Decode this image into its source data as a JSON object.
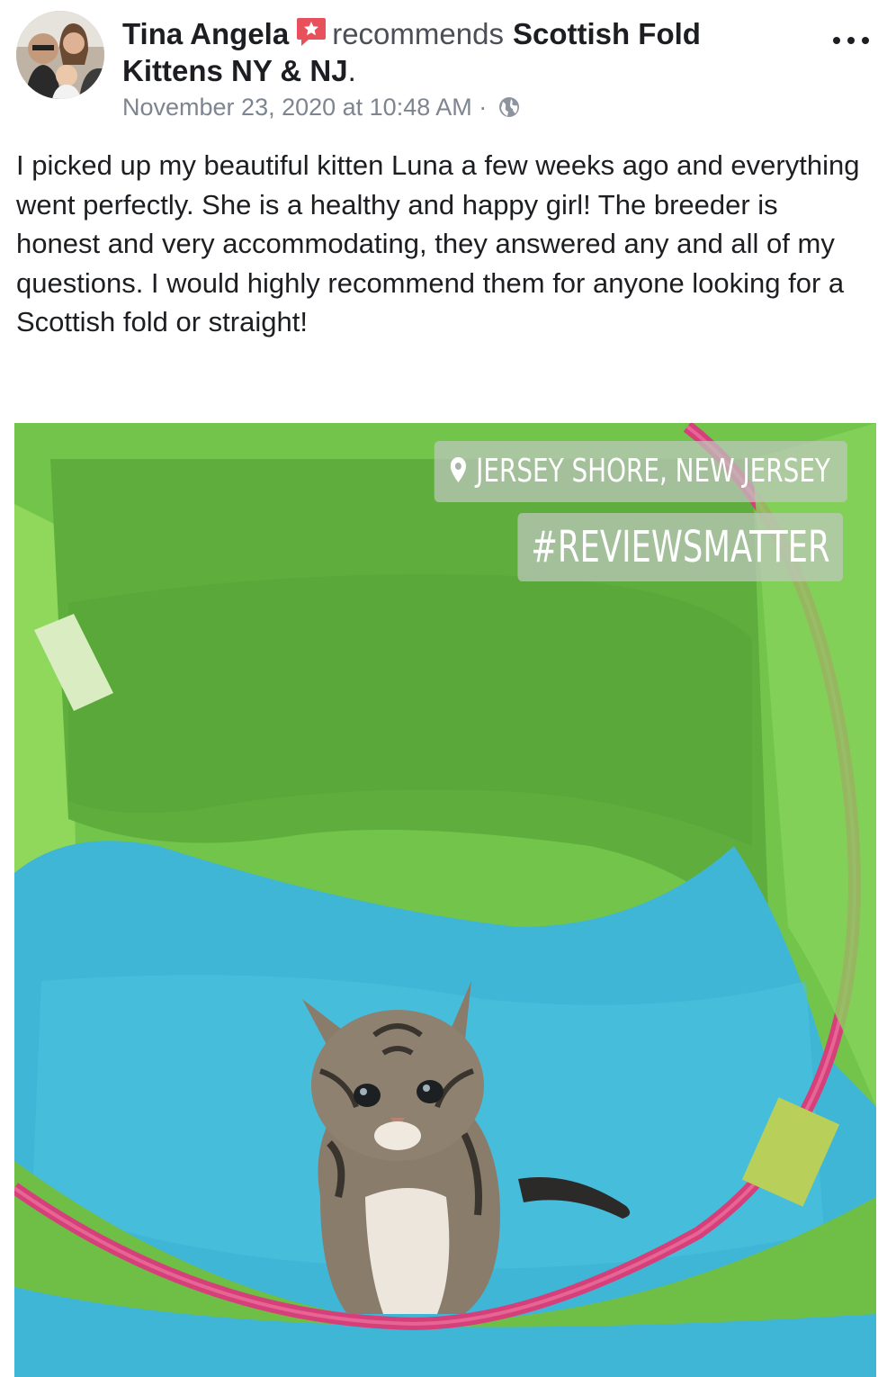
{
  "post": {
    "author_name": "Tina Angela",
    "recommends_text": "recommends",
    "page_name_part1": "Scottish Fold",
    "page_name_part2": "Kittens NY & NJ",
    "page_name_suffix": ".",
    "timestamp": "November 23, 2020 at 10:48 AM",
    "timestamp_separator": " · ",
    "body_text": "I picked up my beautiful kitten Luna a few weeks ago and everything went perfectly. She is a healthy and happy girl! The breeder is honest and very accommodating, they answered any and all of my questions. I would highly recommend them for anyone looking for a Scottish fold or straight!"
  },
  "photo": {
    "location_sticker": "JERSEY SHORE, NEW JERSEY",
    "hashtag_sticker": "#REVIEWSMATTER"
  },
  "icons": {
    "recommend": "recommend-star-icon",
    "audience": "globe-icon",
    "more": "more-options-icon",
    "location": "location-pin-icon"
  },
  "colors": {
    "recommend_badge": "#e8505b",
    "tent_green": "#6fc24a",
    "tent_blue": "#3fb6d6",
    "tent_trim": "#d6407a"
  }
}
